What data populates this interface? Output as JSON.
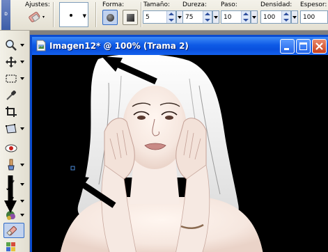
{
  "toolbar": {
    "grip_label": "ᴅ",
    "presets_label": "Ajustes:",
    "shape_label": "Forma:",
    "fields": [
      {
        "label": "Tamaño:",
        "value": "5"
      },
      {
        "label": "Dureza:",
        "value": "75"
      },
      {
        "label": "Paso:",
        "value": "10"
      },
      {
        "label": "Densidad:",
        "value": "100"
      },
      {
        "label": "Espesor:",
        "value": "100"
      }
    ]
  },
  "tools": [
    {
      "name": "zoom-tool",
      "icon": "magnifier-icon"
    },
    {
      "name": "move-tool",
      "icon": "move-cross-icon"
    },
    {
      "name": "selection-tool",
      "icon": "marquee-icon"
    },
    {
      "name": "eyedropper-tool",
      "icon": "dropper-icon"
    },
    {
      "name": "crop-tool",
      "icon": "crop-icon"
    },
    {
      "name": "deform-tool",
      "icon": "deform-icon"
    },
    {
      "name": "red-eye-tool",
      "icon": "eye-icon"
    },
    {
      "name": "clone-tool",
      "icon": "clone-icon"
    },
    {
      "name": "paint-brush-tool",
      "icon": "brush-icon"
    },
    {
      "name": "airbrush-tool",
      "icon": "airbrush-icon"
    },
    {
      "name": "flood-fill-tool",
      "icon": "bucket-icon"
    },
    {
      "name": "eraser-tool",
      "icon": "eraser-icon"
    },
    {
      "name": "picture-tube-tool",
      "icon": "tube-icon"
    }
  ],
  "document": {
    "title": "Imagen12* @ 100% (Trama 2)"
  },
  "colors": {
    "titlebar": "#0a4bd0",
    "canvas": "#000000",
    "accent": "#316ac5"
  }
}
